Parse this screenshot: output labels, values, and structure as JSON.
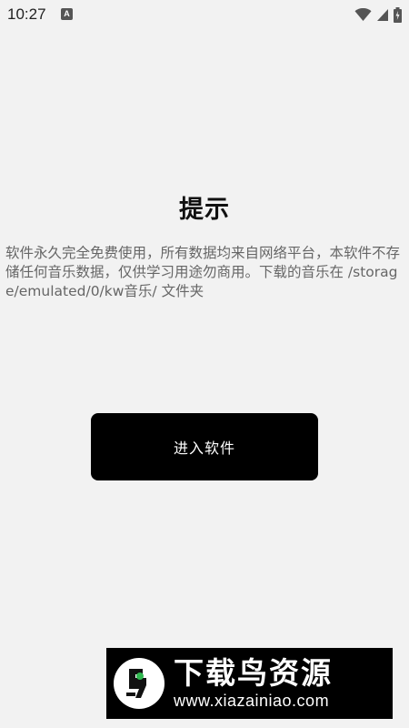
{
  "status_bar": {
    "time": "10:27",
    "notification_icon_glyph": "A",
    "icons": [
      "notification-icon",
      "wifi-icon",
      "signal-icon",
      "battery-icon"
    ]
  },
  "dialog": {
    "title": "提示",
    "message": "软件永久完全免费使用，所有数据均来自网络平台，本软件不存储任何音乐数据，仅供学习用途勿商用。下载的音乐在 /storage/emulated/0/kw音乐/ 文件夹",
    "button_label": "进入软件"
  },
  "watermark": {
    "name": "下载鸟资源",
    "url": "www.xiazainiao.com"
  },
  "colors": {
    "background": "#f2f2f2",
    "button": "#000000",
    "button_text": "#ffffff",
    "message_text": "#666666",
    "logo_accent": "#2fb84f"
  }
}
